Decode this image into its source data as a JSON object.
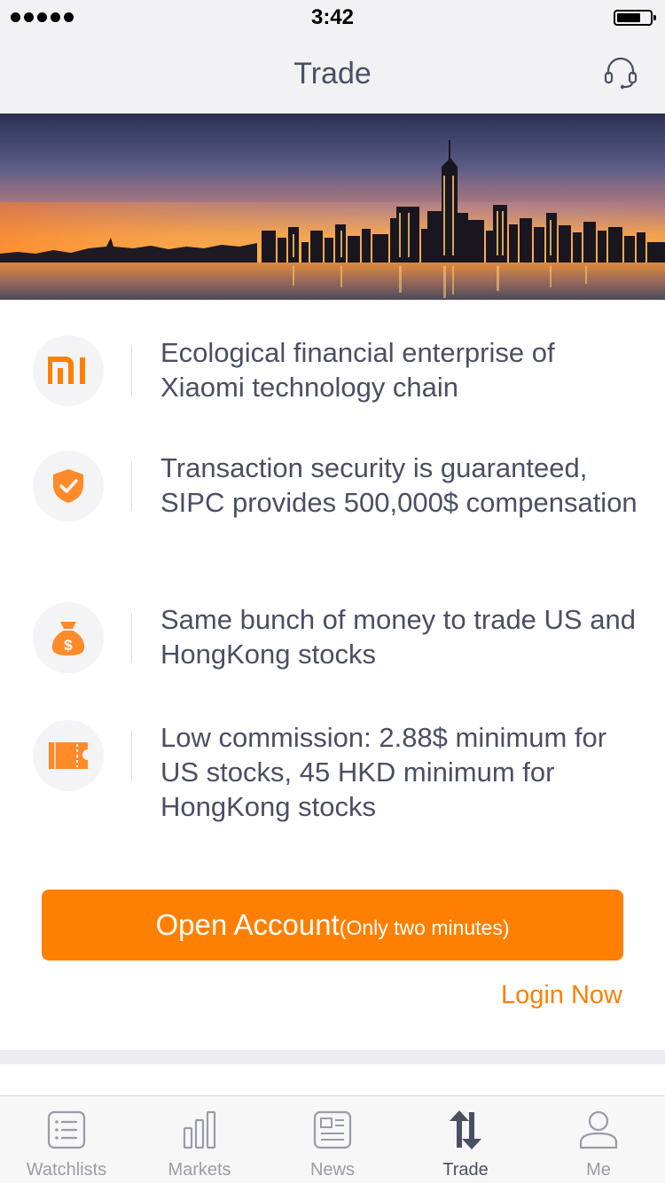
{
  "status_bar": {
    "time": "3:42"
  },
  "header": {
    "title": "Trade",
    "support_icon": "headset-icon"
  },
  "hero": {
    "image": "city-skyline-sunset"
  },
  "features": [
    {
      "icon": "mi-logo-icon",
      "text": "Ecological financial enterprise of Xiaomi technology chain"
    },
    {
      "icon": "shield-check-icon",
      "text": "Transaction security is guaranteed, SIPC provides 500,000$ compensation"
    },
    {
      "icon": "money-bag-icon",
      "text": "Same bunch of money to trade US and HongKong stocks"
    },
    {
      "icon": "ticket-icon",
      "text": "Low commission: 2.88$ minimum for US stocks, 45 HKD minimum for HongKong stocks"
    }
  ],
  "actions": {
    "open_account_label": "Open Account",
    "open_account_note": "(Only two minutes)",
    "login_label": "Login Now"
  },
  "tab_bar": {
    "tabs": [
      {
        "label": "Watchlists",
        "icon": "list-icon",
        "active": false
      },
      {
        "label": "Markets",
        "icon": "bar-chart-icon",
        "active": false
      },
      {
        "label": "News",
        "icon": "newspaper-icon",
        "active": false
      },
      {
        "label": "Trade",
        "icon": "trade-arrows-icon",
        "active": true
      },
      {
        "label": "Me",
        "icon": "person-icon",
        "active": false
      }
    ]
  },
  "colors": {
    "accent": "#ff7f00",
    "text": "#4a4f63",
    "muted": "#9a9ca6",
    "bar_background": "#f2f2f4"
  }
}
